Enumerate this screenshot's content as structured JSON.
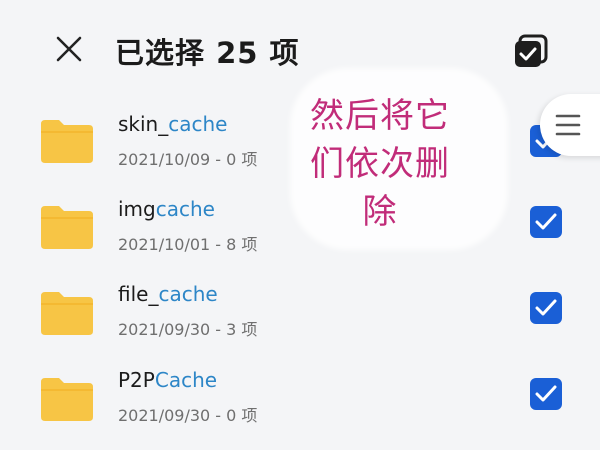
{
  "header": {
    "title": "已选择 25 项"
  },
  "caption": {
    "text": "然后将它们依次删除"
  },
  "files": [
    {
      "name_plain": "skin_",
      "name_accent": "cache",
      "meta": "2021/10/09 - 0 项",
      "checked": true
    },
    {
      "name_plain": "img",
      "name_accent": "cache",
      "meta": "2021/10/01 - 8 项",
      "checked": true
    },
    {
      "name_plain": "file_",
      "name_accent": "cache",
      "meta": "2021/09/30 - 3 项",
      "checked": true
    },
    {
      "name_plain": "P2P",
      "name_accent": "Cache",
      "meta": "2021/09/30 - 0 项",
      "checked": true
    }
  ],
  "colors": {
    "folder": "#f7c545",
    "checkbox": "#1a5fd6",
    "accent_text": "#2d86c7",
    "caption_text": "#c12c79"
  },
  "icons": {
    "close": "close-icon",
    "select_all": "select-all-icon",
    "folder": "folder-icon",
    "menu": "menu-lines-icon",
    "check": "check-icon"
  }
}
